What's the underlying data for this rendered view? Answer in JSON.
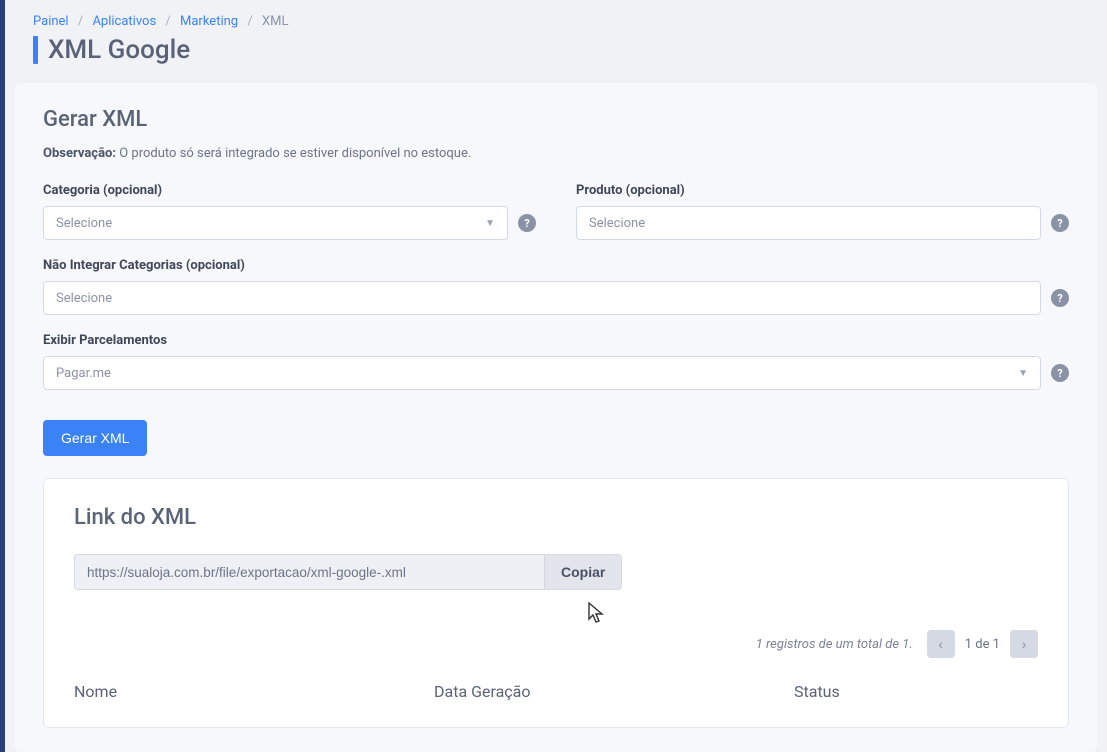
{
  "breadcrumb": {
    "items": [
      "Painel",
      "Aplicativos",
      "Marketing"
    ],
    "current": "XML"
  },
  "page_title": "XML Google",
  "form": {
    "section_title": "Gerar XML",
    "obs_label": "Observação:",
    "obs_text": "O produto só será integrado se estiver disponível no estoque.",
    "categoria": {
      "label": "Categoria (opcional)",
      "value": "Selecione"
    },
    "produto": {
      "label": "Produto (opcional)",
      "value": "Selecione"
    },
    "nao_integrar": {
      "label": "Não Integrar Categorias (opcional)",
      "value": "Selecione"
    },
    "parcelamentos": {
      "label": "Exibir Parcelamentos",
      "value": "Pagar.me"
    },
    "submit_label": "Gerar XML"
  },
  "link_section": {
    "title": "Link do XML",
    "url": "https://sualoja.com.br/file/exportacao/xml-google-.xml",
    "copy_label": "Copiar"
  },
  "pagination": {
    "summary": "1 registros de um total de 1.",
    "page_label": "1 de 1"
  },
  "table": {
    "headers": {
      "nome": "Nome",
      "data": "Data Geração",
      "status": "Status"
    }
  }
}
